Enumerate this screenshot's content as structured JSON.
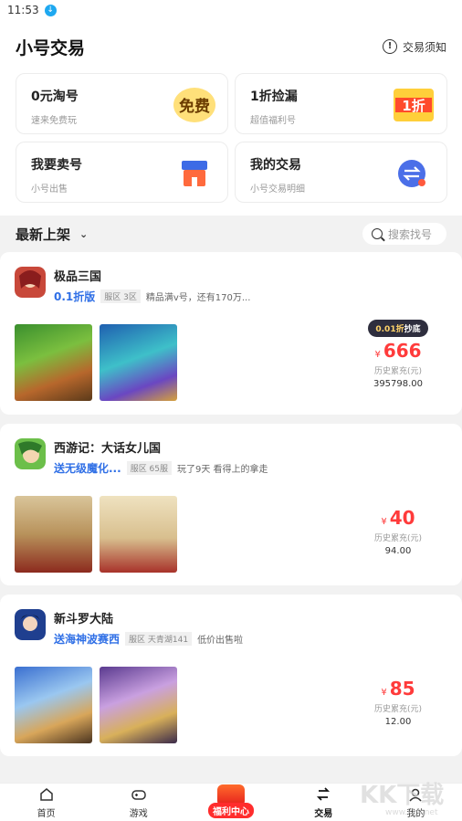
{
  "status": {
    "time": "11:53"
  },
  "header": {
    "title": "小号交易",
    "notice": "交易须知"
  },
  "cards": [
    {
      "title": "0元淘号",
      "sub": "速来免费玩",
      "art": "免费"
    },
    {
      "title": "1折捡漏",
      "sub": "超值福利号",
      "art": "1折"
    },
    {
      "title": "我要卖号",
      "sub": "小号出售"
    },
    {
      "title": "我的交易",
      "sub": "小号交易明细"
    }
  ],
  "section": {
    "title": "最新上架",
    "search_placeholder": "搜索找号"
  },
  "listings": [
    {
      "name": "极品三国",
      "platform": "0.1折版",
      "server": "服区 3区",
      "desc": "精品满v号，还有170万...",
      "discount_prefix": "0.01折",
      "discount_suffix": "抄底",
      "currency": "¥",
      "price": "666",
      "hist_label": "历史累充(元)",
      "hist_value": "395798.00"
    },
    {
      "name": "西游记：大话女儿国",
      "platform": "送无级魔化...",
      "server": "服区 65服",
      "desc": "玩了9天 看得上的拿走",
      "currency": "¥",
      "price": "40",
      "hist_label": "历史累充(元)",
      "hist_value": "94.00"
    },
    {
      "name": "新斗罗大陆",
      "platform": "送海神波赛西",
      "server": "服区 天青湖141",
      "desc": "低价出售啦",
      "currency": "¥",
      "price": "85",
      "hist_label": "历史累充(元)",
      "hist_value": "12.00"
    }
  ],
  "tabs": [
    {
      "label": "首页"
    },
    {
      "label": "游戏"
    },
    {
      "label": "福利中心"
    },
    {
      "label": "交易"
    },
    {
      "label": "我的"
    }
  ],
  "watermark": "KK下载 www.kkx.net"
}
